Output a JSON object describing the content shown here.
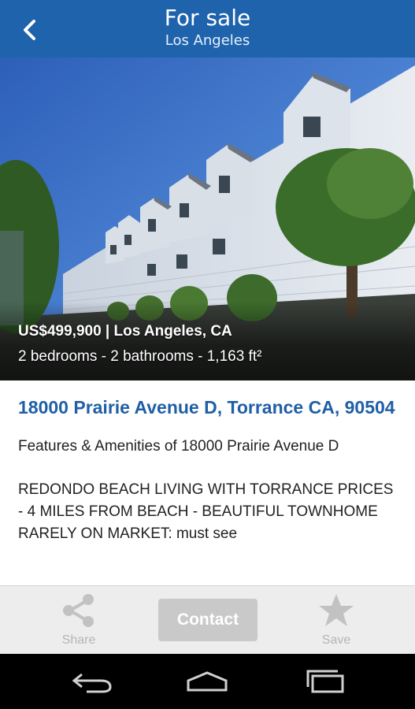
{
  "header": {
    "title": "For sale",
    "subtitle": "Los Angeles",
    "back_icon": "chevron-left-icon"
  },
  "listing": {
    "price_location": "US$499,900 | Los Angeles, CA",
    "details": "2 bedrooms - 2 bathrooms - 1,163 ft²",
    "address": "18000 Prairie Avenue D, Torrance CA, 90504",
    "features_heading": "Features & Amenities of 18000 Prairie Avenue D",
    "description": "REDONDO BEACH LIVING WITH TORRANCE PRICES - 4 MILES FROM BEACH - BEAUTIFUL TOWNHOME RARELY ON MARKET: must see"
  },
  "actions": {
    "share_label": "Share",
    "contact_label": "Contact",
    "save_label": "Save"
  },
  "colors": {
    "header_bg": "#1f63ad",
    "address_text": "#1f5fa6",
    "contact_button": "#c9c9c9"
  }
}
